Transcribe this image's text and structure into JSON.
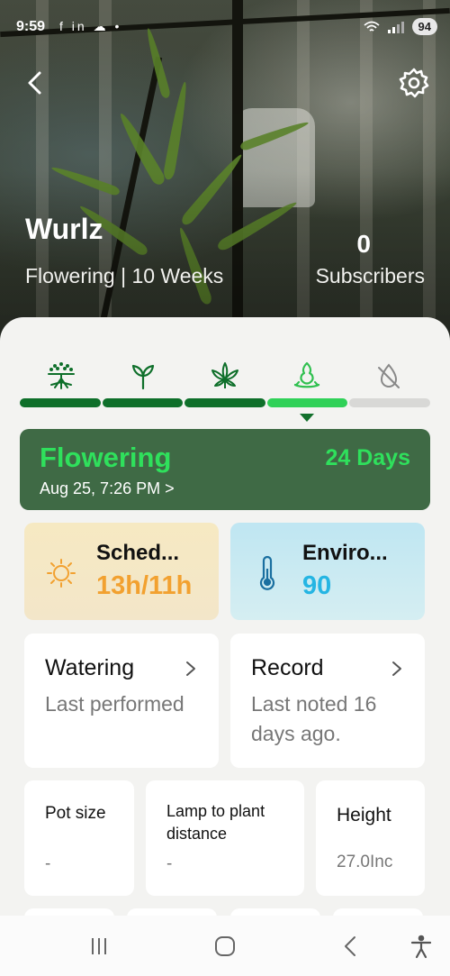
{
  "status_bar": {
    "time": "9:59",
    "notification_icons": "f in ☁ •",
    "battery": "94"
  },
  "plant": {
    "name": "Wurlz",
    "stage_summary": "Flowering | 10 Weeks",
    "subscribers_count": "0",
    "subscribers_label": "Subscribers"
  },
  "stages": [
    {
      "icon": "seed-germination-icon",
      "status": "done"
    },
    {
      "icon": "seedling-icon",
      "status": "done"
    },
    {
      "icon": "cannabis-leaf-icon",
      "status": "done"
    },
    {
      "icon": "flowering-bud-icon",
      "status": "active"
    },
    {
      "icon": "harvest-off-icon",
      "status": "pending"
    }
  ],
  "current_stage": {
    "title": "Flowering",
    "days": "24 Days",
    "date": "Aug 25, 7:26 PM >"
  },
  "schedule": {
    "label": "Sched...",
    "value": "13h/11h",
    "icon": "sun-icon"
  },
  "environment": {
    "label": "Enviro...",
    "value": "90",
    "icon": "thermometer-icon"
  },
  "watering": {
    "title": "Watering",
    "desc": "Last performed"
  },
  "record": {
    "title": "Record",
    "desc": "Last noted 16 days ago."
  },
  "pot_size": {
    "title": "Pot size",
    "value": "-"
  },
  "lamp_distance": {
    "title": "Lamp to plant distance",
    "value": "-"
  },
  "height": {
    "title": "Height",
    "value": "27.0Inc"
  },
  "colors": {
    "active_green": "#30d158",
    "done_green": "#0e6f2a",
    "stage_card_bg": "#3f6a45",
    "schedule_accent": "#f2a130",
    "environment_accent": "#25b5e3"
  },
  "navbar": [
    "recent-apps-icon",
    "home-icon",
    "back-icon",
    "accessibility-icon"
  ]
}
